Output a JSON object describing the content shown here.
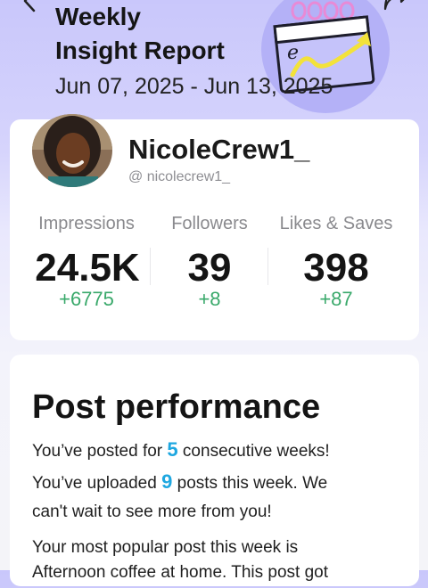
{
  "header": {
    "title_line1": "Weekly",
    "title_line2": "Insight Report",
    "date_range": "Jun 07, 2025 - Jun 13, 2025"
  },
  "profile": {
    "username": "NicoleCrew1_",
    "handle": "@ nicolecrew1_"
  },
  "stats": [
    {
      "label": "Impressions",
      "value": "24.5K",
      "delta": "+6775"
    },
    {
      "label": "Followers",
      "value": "39",
      "delta": "+8"
    },
    {
      "label": "Likes & Saves",
      "value": "398",
      "delta": "+87"
    }
  ],
  "performance": {
    "title": "Post performance",
    "line1_pre": "You’ve posted for ",
    "line1_num": "5",
    "line1_post": " consecutive weeks!",
    "line2_pre": "You’ve uploaded ",
    "line2_num": "9",
    "line2_post": " posts this week. We",
    "line3": "can't wait to see more from you!",
    "line4": "Your most popular post this week is",
    "line5": "Afternoon coffee at home. This post got"
  },
  "colors": {
    "accent": "#1ea7e0",
    "delta_green": "#3aa96b",
    "header_bg": "#c9c7fb"
  },
  "icons": {
    "back": "chevron-left-icon",
    "share": "share-icon",
    "illustration": "calendar-growth-illustration"
  }
}
